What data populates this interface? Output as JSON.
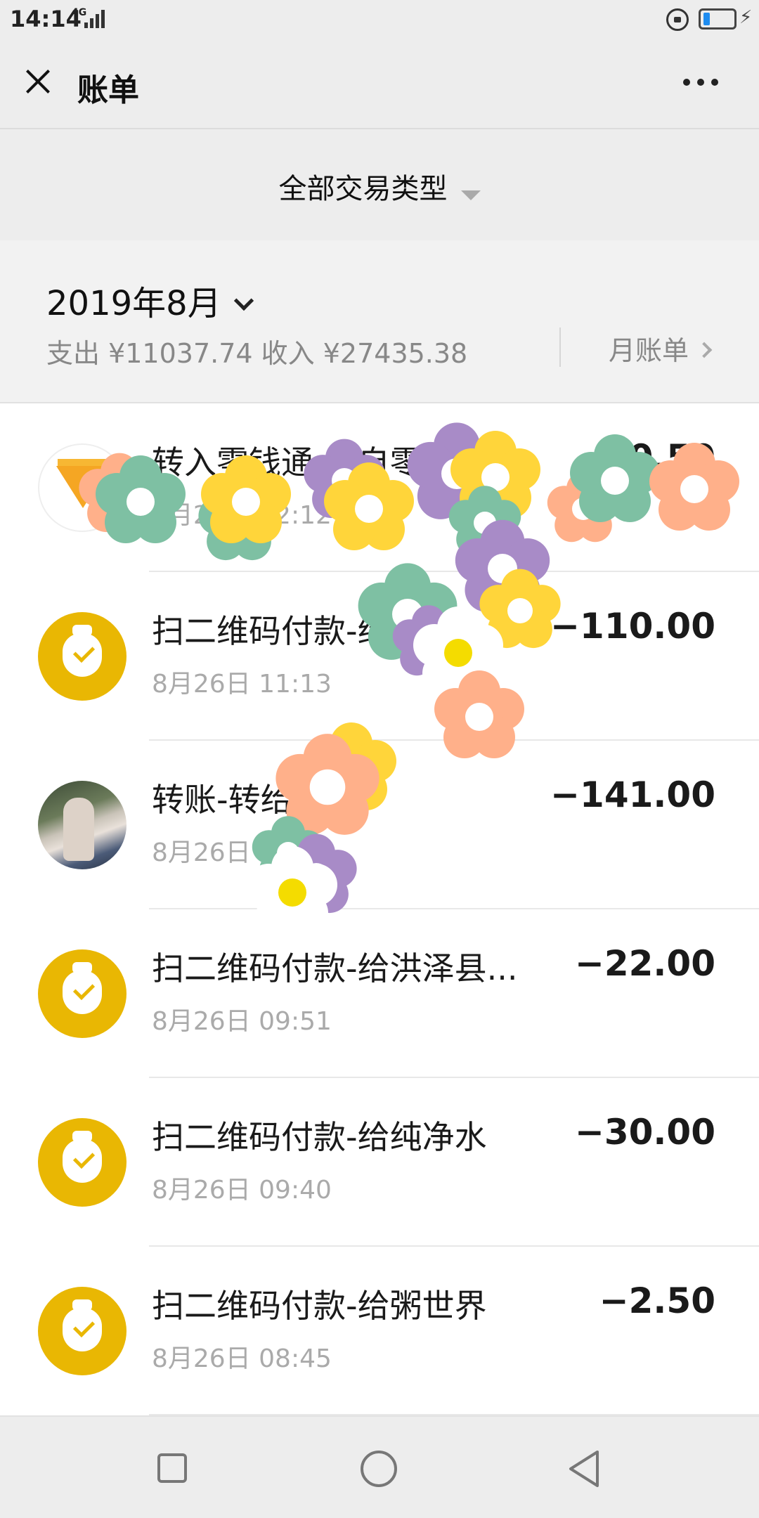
{
  "status": {
    "time": "14:14",
    "network": "4G"
  },
  "header": {
    "title": "账单"
  },
  "filter": {
    "label": "全部交易类型"
  },
  "month": {
    "title": "2019年8月",
    "summary": "支出 ¥11037.74 收入 ¥27435.38",
    "bill_link": "月账单"
  },
  "transactions": [
    {
      "title": "转入零钱通-来自零钱",
      "time": "8月26日 12:12",
      "amount": "-20.50",
      "avatar": "diamond-icon"
    },
    {
      "title": "扫二维码付款-给",
      "time": "8月26日 11:13",
      "amount": "−110.00",
      "avatar": "money-bag-icon"
    },
    {
      "title": "转账-转给",
      "time": "8月26日",
      "amount": "−141.00",
      "avatar": "photo"
    },
    {
      "title": "扫二维码付款-给洪泽县...",
      "time": "8月26日 09:51",
      "amount": "−22.00",
      "avatar": "money-bag-icon"
    },
    {
      "title": "扫二维码付款-给纯净水",
      "time": "8月26日 09:40",
      "amount": "−30.00",
      "avatar": "money-bag-icon"
    },
    {
      "title": "扫二维码付款-给粥世界",
      "time": "8月26日 08:45",
      "amount": "−2.50",
      "avatar": "money-bag-icon"
    }
  ],
  "colors": {
    "avatar_gold": "#e9b703",
    "flower_green": "#7ec0a3",
    "flower_yellow": "#ffd53a",
    "flower_purple": "#a88bc7",
    "flower_peach": "#ffb08a"
  }
}
